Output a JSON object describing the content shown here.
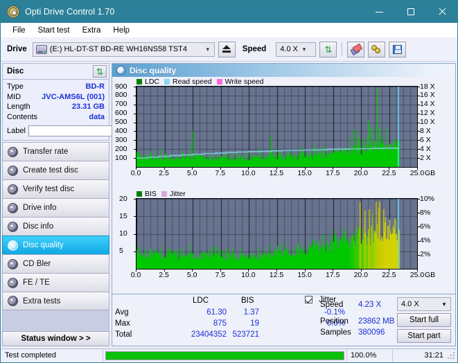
{
  "window": {
    "title": "Opti Drive Control 1.70",
    "icon": "disc-icon",
    "minimize": "minimize-icon",
    "maximize": "maximize-icon",
    "close": "close-icon"
  },
  "menu": [
    "File",
    "Start test",
    "Extra",
    "Help"
  ],
  "toolbar": {
    "drive_label": "Drive",
    "drive_value": "(E:)  HL-DT-ST BD-RE  WH16NS58 TST4",
    "eject_icon": "eject-icon",
    "speed_label": "Speed",
    "speed_value": "4.0 X",
    "refresh_icon": "refresh-icon",
    "eraser_icon": "eraser-icon",
    "gear_icon": "gear-icon",
    "save_icon": "save-icon"
  },
  "sidebar": {
    "disc_panel": {
      "title": "Disc",
      "refresh_icon": "refresh-icon",
      "rows": [
        {
          "key": "Type",
          "value": "BD-R"
        },
        {
          "key": "MID",
          "value": "JVC-AMS6L (001)"
        },
        {
          "key": "Length",
          "value": "23.31 GB"
        },
        {
          "key": "Contents",
          "value": "data"
        }
      ],
      "label_key": "Label",
      "label_value": "",
      "label_placeholder": "",
      "disc_button_icon": "cd-icon"
    },
    "nav": [
      {
        "label": "Transfer rate",
        "icon": "disc-icon",
        "active": false
      },
      {
        "label": "Create test disc",
        "icon": "disc-icon",
        "active": false
      },
      {
        "label": "Verify test disc",
        "icon": "disc-icon",
        "active": false
      },
      {
        "label": "Drive info",
        "icon": "disc-icon",
        "active": false
      },
      {
        "label": "Disc info",
        "icon": "disc-icon",
        "active": false
      },
      {
        "label": "Disc quality",
        "icon": "disc-icon",
        "active": true
      },
      {
        "label": "CD Bler",
        "icon": "disc-icon",
        "active": false
      },
      {
        "label": "FE / TE",
        "icon": "disc-icon",
        "active": false
      },
      {
        "label": "Extra tests",
        "icon": "disc-icon",
        "active": false
      }
    ],
    "status_window_button": "Status window > >"
  },
  "main": {
    "title": "Disc quality",
    "icon": "disc-quality-icon"
  },
  "stats": {
    "col_ldc": "LDC",
    "col_bis": "BIS",
    "jitter_label": "Jitter",
    "jitter_checked": true,
    "rows": [
      {
        "label": "Avg",
        "ldc": "61.30",
        "bis": "1.37",
        "jitter": "-0.1%"
      },
      {
        "label": "Max",
        "ldc": "875",
        "bis": "19",
        "jitter": "0.0%"
      },
      {
        "label": "Total",
        "ldc": "23404352",
        "bis": "523721",
        "jitter": ""
      }
    ],
    "speed_label": "Speed",
    "speed_value": "4.23 X",
    "position_label": "Position",
    "position_value": "23862 MB",
    "samples_label": "Samples",
    "samples_value": "380096",
    "speed_select": "4.0 X",
    "start_full": "Start full",
    "start_part": "Start part"
  },
  "statusbar": {
    "message": "Test completed",
    "percent_text": "100.0%",
    "percent_value": 100,
    "elapsed": "31:21",
    "grip_icon": "resize-grip-icon"
  },
  "colors": {
    "accent": "#2d8099",
    "ldc_green": "#00c800",
    "bis_green": "#00c800",
    "jitter_pink": "#d8a8d8",
    "read_speed": "#69d8f7",
    "write_speed": "#ff3fd0",
    "plot_bg": "#68748f",
    "value_blue": "#1a30d8",
    "progress_green": "#0cbf0c"
  },
  "chart_data": [
    {
      "type": "area",
      "name": "disc-quality-ldc",
      "title": "Disc quality",
      "legend": [
        {
          "label": "LDC",
          "color": "#008000"
        },
        {
          "label": "Read speed",
          "color": "#87d9f0"
        },
        {
          "label": "Write speed",
          "color": "#ff66dd"
        }
      ],
      "legend_position": "top-left",
      "xlabel": "GB",
      "xlim": [
        0.0,
        25.0
      ],
      "xticks": [
        "0.0",
        "2.5",
        "5.0",
        "7.5",
        "10.0",
        "12.5",
        "15.0",
        "17.5",
        "20.0",
        "22.5",
        "25.0"
      ],
      "ylabel_left": "LDC",
      "ylim": [
        0,
        900
      ],
      "yticks": [
        100,
        200,
        300,
        400,
        500,
        600,
        700,
        800,
        900
      ],
      "ylabel_right": "Speed",
      "ylim_right": [
        0,
        18
      ],
      "yticks_right": [
        "2 X",
        "4 X",
        "6 X",
        "8 X",
        "10 X",
        "12 X",
        "14 X",
        "16 X",
        "18 X"
      ],
      "grid": true,
      "data_end_gb": 23.4,
      "cursor_gb": 23.3,
      "series": [
        {
          "name": "LDC",
          "color": "#00c800",
          "description": "Dense green spiky envelope; baseline ~110-180 from 0-12 GB with occasional spikes to 300-410, rising after 18 GB with band 250-420 and isolated peak ~875 near 21.3 GB",
          "envelope_x": [
            0.0,
            0.3,
            0.8,
            1.5,
            2.2,
            3.0,
            3.8,
            4.6,
            4.95,
            5.3,
            6.0,
            6.8,
            7.5,
            8.2,
            9.0,
            9.8,
            10.5,
            11.3,
            11.9,
            12.2,
            12.9,
            13.6,
            14.3,
            15.0,
            15.7,
            16.4,
            17.1,
            17.8,
            18.4,
            18.9,
            19.3,
            19.7,
            20.1,
            20.5,
            20.9,
            21.2,
            21.35,
            21.6,
            22.0,
            22.4,
            22.8,
            23.2,
            23.4
          ],
          "envelope_top": [
            350,
            230,
            215,
            205,
            200,
            190,
            205,
            200,
            410,
            200,
            195,
            190,
            200,
            185,
            195,
            200,
            230,
            215,
            355,
            200,
            230,
            215,
            230,
            250,
            240,
            235,
            230,
            250,
            290,
            330,
            420,
            400,
            430,
            420,
            455,
            430,
            875,
            430,
            440,
            430,
            420,
            400,
            360
          ],
          "baseline": [
            180,
            150,
            140,
            130,
            130,
            125,
            125,
            125,
            130,
            120,
            120,
            120,
            125,
            120,
            120,
            125,
            130,
            130,
            135,
            135,
            140,
            145,
            150,
            160,
            170,
            175,
            180,
            185,
            200,
            215,
            230,
            240,
            250,
            265,
            275,
            285,
            290,
            295,
            300,
            300,
            295,
            290,
            285
          ]
        },
        {
          "name": "Read speed",
          "color": "#87d9f0",
          "description": "Stepped rising light-blue curve from ~2.0 X at 0 GB to ~4.3 X at 23.4 GB",
          "x": [
            0.0,
            1.0,
            2.0,
            3.0,
            4.0,
            5.0,
            6.0,
            7.0,
            8.0,
            9.0,
            10.0,
            11.0,
            12.0,
            13.0,
            14.0,
            15.0,
            16.0,
            17.0,
            18.0,
            19.0,
            20.0,
            21.0,
            22.0,
            23.0,
            23.4
          ],
          "y": [
            2.0,
            2.15,
            2.35,
            2.55,
            2.7,
            2.85,
            3.0,
            3.1,
            3.25,
            3.35,
            3.45,
            3.5,
            3.6,
            3.7,
            3.75,
            3.8,
            3.85,
            3.95,
            4.0,
            4.05,
            4.1,
            4.15,
            4.2,
            4.23,
            4.23
          ]
        },
        {
          "name": "Write speed",
          "color": "#ff66dd",
          "description": "not plotted (no data)",
          "x": [],
          "y": []
        }
      ]
    },
    {
      "type": "area",
      "name": "disc-quality-bis",
      "legend": [
        {
          "label": "BIS",
          "color": "#008000"
        },
        {
          "label": "Jitter",
          "color": "#d8a8d8"
        }
      ],
      "legend_position": "top-left",
      "xlabel": "GB",
      "xlim": [
        0.0,
        25.0
      ],
      "xticks": [
        "0.0",
        "2.5",
        "5.0",
        "7.5",
        "10.0",
        "12.5",
        "15.0",
        "17.5",
        "20.0",
        "22.5",
        "25.0"
      ],
      "ylabel_left": "BIS",
      "ylim": [
        0,
        20
      ],
      "yticks": [
        5,
        10,
        15,
        20
      ],
      "ylabel_right": "Jitter",
      "ylim_right": [
        0,
        10
      ],
      "yticks_right": [
        "2%",
        "4%",
        "6%",
        "8%",
        "10%"
      ],
      "grid": true,
      "data_end_gb": 23.4,
      "cursor_gb": 23.3,
      "series": [
        {
          "name": "BIS",
          "color": "#00c800",
          "description": "Dense green bars; baseline band 4-5 from 0-12 GB with spikes to 8-9, rising from 15 GB to band 10-15 with peaks to 19 around 20-22 GB; bars turn yellow-green above ~19 GB",
          "envelope_x": [
            0.0,
            0.3,
            0.7,
            1.2,
            1.8,
            2.4,
            3.0,
            3.6,
            4.2,
            4.9,
            5.4,
            6.0,
            6.6,
            7.2,
            7.8,
            8.4,
            9.0,
            9.6,
            10.2,
            10.8,
            11.4,
            11.9,
            12.3,
            12.9,
            13.5,
            14.1,
            14.7,
            15.2,
            15.8,
            16.4,
            17.0,
            17.4,
            17.9,
            18.4,
            18.9,
            19.4,
            19.9,
            20.3,
            20.7,
            21.0,
            21.3,
            21.6,
            22.0,
            22.4,
            22.8,
            23.1,
            23.4
          ],
          "envelope_top": [
            8.0,
            9.5,
            6.5,
            6.0,
            5.5,
            6.5,
            5.5,
            5.5,
            6.0,
            8.0,
            5.5,
            5.5,
            6.0,
            7.0,
            5.5,
            6.0,
            5.5,
            6.0,
            5.5,
            6.0,
            5.5,
            8.0,
            6.5,
            8.0,
            8.0,
            7.0,
            8.5,
            10.0,
            8.0,
            11.0,
            13.0,
            10.5,
            11.0,
            12.0,
            13.5,
            15.0,
            19.0,
            16.5,
            17.0,
            16.0,
            19.2,
            19.2,
            17.0,
            16.0,
            15.0,
            13.0,
            13.0
          ],
          "baseline": [
            4.6,
            4.8,
            4.8,
            4.7,
            4.7,
            4.6,
            4.6,
            4.6,
            4.6,
            4.7,
            4.6,
            4.5,
            4.5,
            4.5,
            4.5,
            4.5,
            4.4,
            4.4,
            4.4,
            4.4,
            4.4,
            4.8,
            5.0,
            5.2,
            5.4,
            5.6,
            6.0,
            6.4,
            6.8,
            7.2,
            7.8,
            8.0,
            8.4,
            9.0,
            9.6,
            10.4,
            11.2,
            11.8,
            12.2,
            12.5,
            12.8,
            12.9,
            12.6,
            12.2,
            11.8,
            11.2,
            11.0
          ]
        },
        {
          "name": "Jitter",
          "color": "#d8a8d8",
          "description": "not plotted (no samples above threshold)",
          "x": [],
          "y": []
        }
      ]
    }
  ]
}
